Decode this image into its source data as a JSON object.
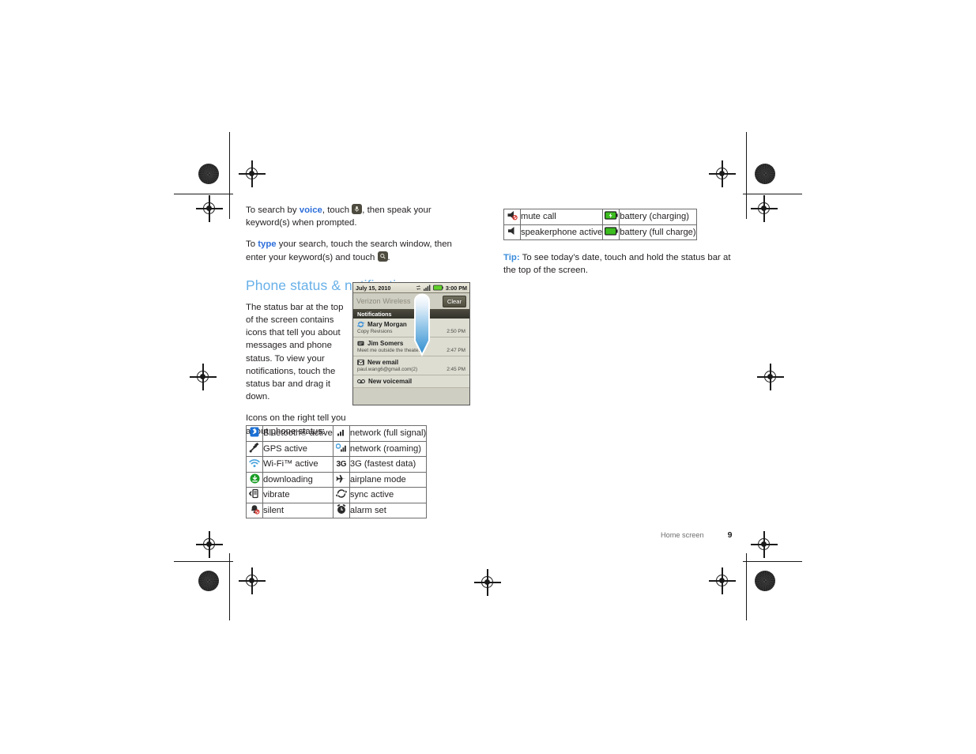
{
  "page": {
    "footer_label": "Home screen",
    "page_number": "9"
  },
  "left_column": {
    "para_voice": {
      "pre": "To search by ",
      "keyword": "voice",
      "mid": ", touch ",
      "post": ", then speak your keyword(s) when prompted.",
      "icon": "microphone-icon"
    },
    "para_type": {
      "pre": "To ",
      "keyword": "type",
      "mid": " your search, touch the search window, then enter your keyword(s) and touch ",
      "post": ".",
      "icon": "search-icon"
    },
    "section_heading": "Phone status & notifications",
    "para_statusbar": "The status bar at the top of the screen contains icons that tell you about messages and phone status. To view your notifications, touch the status bar and drag it down.",
    "para_icons_right": "Icons on the right tell you about phone status:"
  },
  "right_column": {
    "tip_label": "Tip:",
    "tip_text": " To see today’s date, touch and hold the status bar at the top of the screen."
  },
  "phone_screenshot": {
    "status_bar": {
      "date": "July 15, 2010",
      "clock": "3:00 PM",
      "icons": [
        "sync-icon",
        "signal-bars-icon",
        "battery-icon"
      ]
    },
    "carrier": "Verizon Wireless",
    "clear_button": "Clear",
    "notifications_header": "Notifications",
    "drag_arrow": {
      "name": "drag-down-arrow",
      "color_top": "#ffffff",
      "color_bottom": "#2e8ed0"
    },
    "notifications": [
      {
        "icon": "sync-circular-arrows-icon",
        "title": "Mary Morgan",
        "subtitle": "Copy Revisions",
        "time": "2:50 PM"
      },
      {
        "icon": "message-envelope-icon",
        "title": "Jim Somers",
        "subtitle": "Meet me outside the theater...",
        "time": "2:47 PM"
      },
      {
        "icon": "gmail-envelope-icon",
        "title": "New email",
        "subtitle": "paul.wang6@gmail.com(2)",
        "time": "2:45 PM"
      },
      {
        "icon": "voicemail-tape-icon",
        "title": "New voicemail",
        "subtitle": "",
        "time": ""
      }
    ]
  },
  "icon_table_left": {
    "rows": [
      {
        "icon_a": "bluetooth-icon",
        "label_a": "Bluetooth® active",
        "icon_b": "network-signal-icon",
        "label_b": "network (full signal)"
      },
      {
        "icon_a": "gps-satellite-icon",
        "label_a": "GPS active",
        "icon_b": "network-roaming-icon",
        "label_b": "network (roaming)"
      },
      {
        "icon_a": "wifi-icon",
        "label_a": "Wi-Fi™ active",
        "icon_b": "3g-icon",
        "label_b": "3G (fastest data)"
      },
      {
        "icon_a": "download-arrow-icon",
        "label_a": "downloading",
        "icon_b": "airplane-icon",
        "label_b": "airplane mode"
      },
      {
        "icon_a": "vibrate-icon",
        "label_a": "vibrate",
        "icon_b": "sync-arrows-icon",
        "label_b": "sync active"
      },
      {
        "icon_a": "silent-bell-icon",
        "label_a": "silent",
        "icon_b": "alarm-clock-icon",
        "label_b": "alarm set"
      }
    ]
  },
  "icon_table_right": {
    "rows": [
      {
        "icon_a": "mute-call-icon",
        "label_a": "mute call",
        "icon_b": "battery-charging-icon",
        "label_b": "battery (charging)"
      },
      {
        "icon_a": "speakerphone-icon",
        "label_a": "speakerphone active",
        "icon_b": "battery-full-icon",
        "label_b": "battery (full charge)"
      }
    ]
  },
  "colors": {
    "heading": "#68b0e8",
    "keyword": "#2e6fdb",
    "tip": "#3a8ddb",
    "phone_bg": "#cfcec2",
    "battery_green": "#5fd02a"
  }
}
